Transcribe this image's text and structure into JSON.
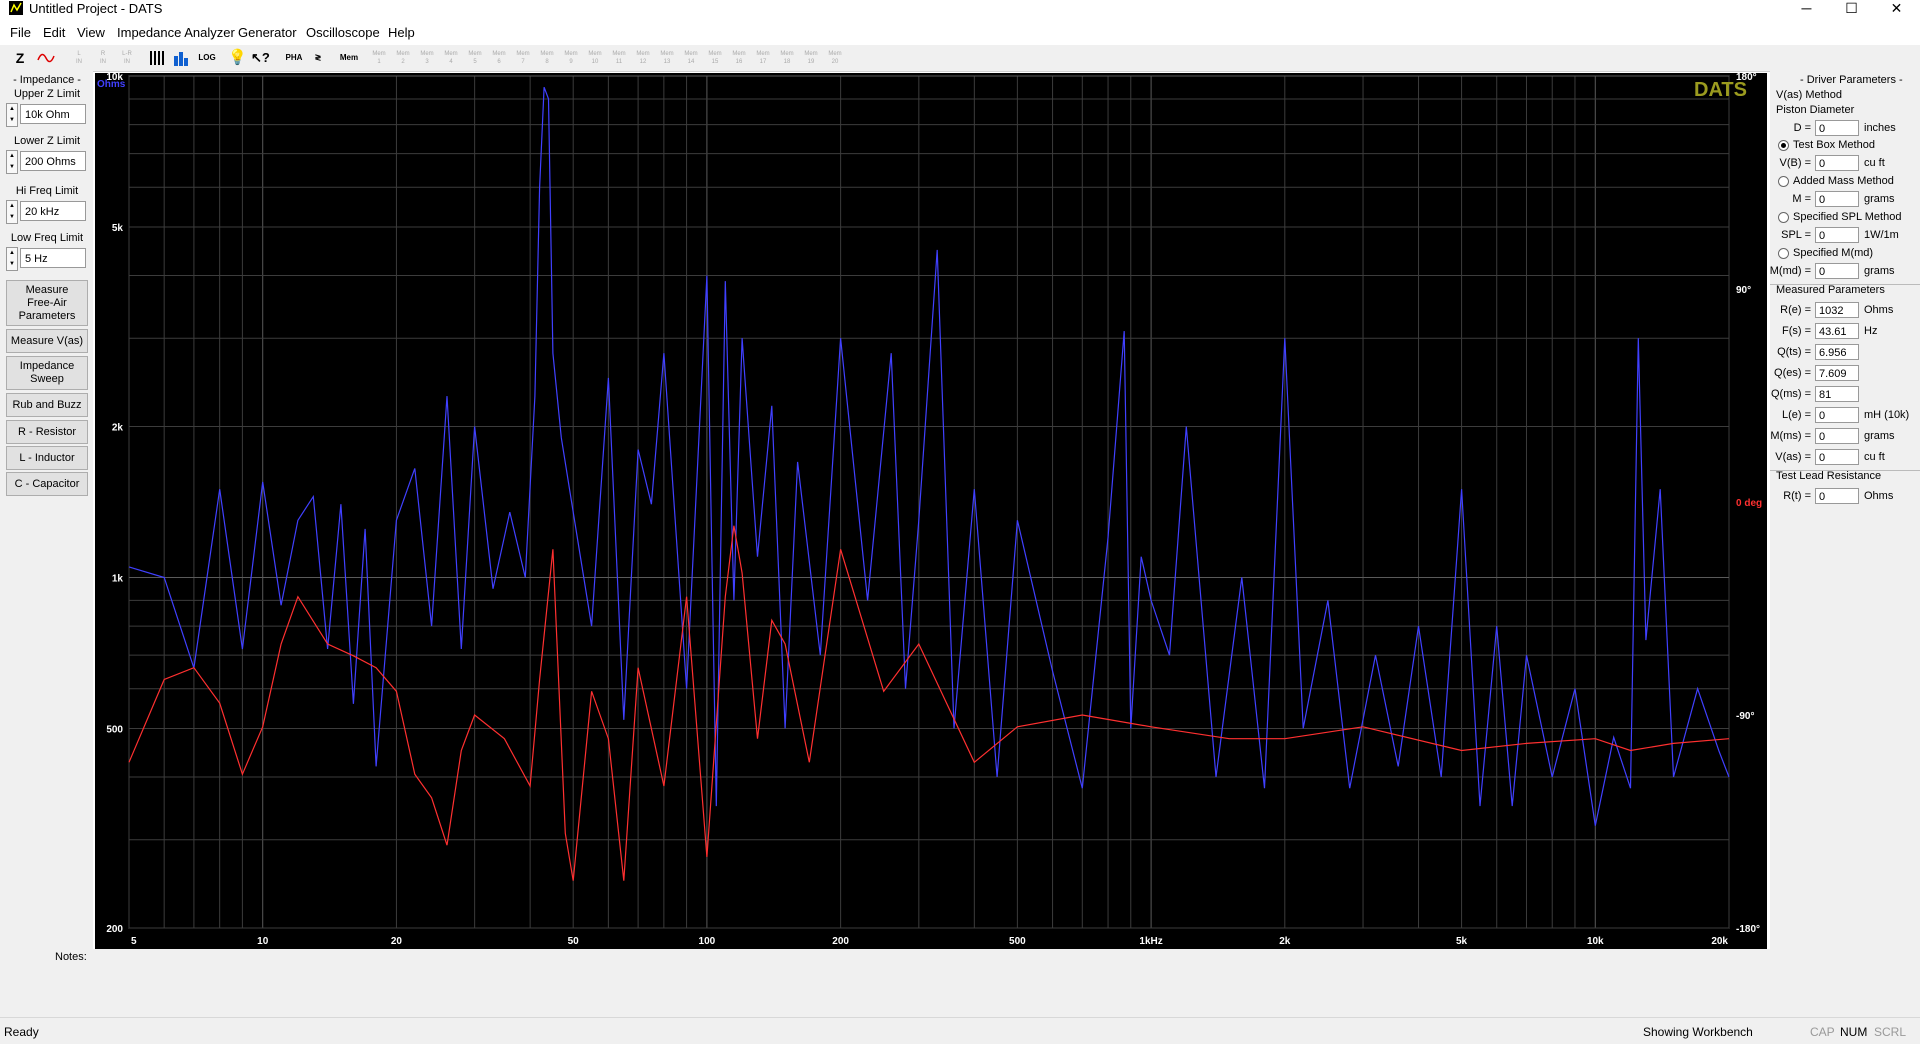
{
  "window": {
    "title": "Untitled Project - DATS",
    "minimize": "─",
    "maximize": "☐",
    "close": "✕"
  },
  "menu": [
    "File",
    "Edit",
    "View",
    "Impedance Analyzer",
    "Generator",
    "Oscilloscope",
    "Help"
  ],
  "toolbar": {
    "z_label": "Z",
    "pha_label": "PHA",
    "mem_label": "Mem"
  },
  "left_panel": {
    "impedance_heading": "- Impedance -",
    "upper_z_label": "Upper Z Limit",
    "upper_z_value": "10k Ohm",
    "lower_z_label": "Lower Z Limit",
    "lower_z_value": "200 Ohms",
    "hi_freq_label": "Hi Freq Limit",
    "hi_freq_value": "20 kHz",
    "low_freq_label": "Low Freq Limit",
    "low_freq_value": "5 Hz",
    "buttons": {
      "measure_free_air": [
        "Measure",
        "Free-Air",
        "Parameters"
      ],
      "measure_vas": "Measure V(as)",
      "impedance_sweep": [
        "Impedance",
        "Sweep"
      ],
      "rub_and_buzz": "Rub and Buzz",
      "resistor": "R - Resistor",
      "inductor": "L - Inductor",
      "capacitor": "C - Capacitor"
    }
  },
  "plot": {
    "watermark": "DATS",
    "left_unit": "Ohms",
    "left_ticks": [
      "10k",
      "5k",
      "2k",
      "1k",
      "500",
      "200"
    ],
    "right_ticks": [
      "180°",
      "90°",
      "0 deg",
      "-90°",
      "-180°"
    ],
    "x_ticks": [
      "5",
      "10",
      "20",
      "50",
      "100",
      "200",
      "500",
      "1kHz",
      "2k",
      "5k",
      "10k",
      "20k"
    ]
  },
  "right_panel": {
    "driver_heading": "- Driver Parameters -",
    "vas_method": "V(as) Method",
    "piston_diameter": "Piston Diameter",
    "d_label": "D =",
    "d_value": "0",
    "d_unit": "inches",
    "test_box": "Test Box Method",
    "vb_label": "V(B) =",
    "vb_value": "0",
    "vb_unit": "cu ft",
    "added_mass": "Added Mass Method",
    "m_label": "M =",
    "m_value": "0",
    "m_unit": "grams",
    "specified_spl": "Specified SPL Method",
    "spl_label": "SPL =",
    "spl_value": "0",
    "spl_unit": "1W/1m",
    "specified_mmd": "Specified M(md)",
    "mmd_label": "M(md) =",
    "mmd_value": "0",
    "mmd_unit": "grams",
    "measured_heading": "Measured Parameters",
    "re_label": "R(e) =",
    "re_value": "1032",
    "re_unit": "Ohms",
    "fs_label": "F(s) =",
    "fs_value": "43.61",
    "fs_unit": "Hz",
    "qts_label": "Q(ts) =",
    "qts_value": "6.956",
    "qes_label": "Q(es) =",
    "qes_value": "7.609",
    "qms_label": "Q(ms) =",
    "qms_value": "81",
    "le_label": "L(e) =",
    "le_value": "0",
    "le_unit": "mH (10k)",
    "mms_label": "M(ms) =",
    "mms_value": "0",
    "mms_unit": "grams",
    "vas_label": "V(as) =",
    "vas_value": "0",
    "vas_unit": "cu ft",
    "lead_heading": "Test Lead Resistance",
    "rt_label": "R(t) =",
    "rt_value": "0",
    "rt_unit": "Ohms"
  },
  "notes_label": "Notes:",
  "status": {
    "ready": "Ready",
    "mode": "Showing Workbench",
    "cap": "CAP",
    "num": "NUM",
    "scrl": "SCRL"
  },
  "colors": {
    "impedance": "#4040ff",
    "phase": "#ff3030",
    "watermark": "#9b9b1f",
    "grid": "#3c3c3c"
  },
  "chart_data": {
    "type": "line",
    "xscale": "log",
    "yscale": "log",
    "xlim": [
      5,
      20000
    ],
    "ylim": [
      200,
      10000
    ],
    "y2lim": [
      -180,
      180
    ],
    "series": [
      {
        "axis": "left",
        "x": [
          5,
          6,
          7,
          8,
          9,
          10,
          11,
          12,
          13,
          14,
          15,
          16,
          17,
          18,
          20,
          22,
          24,
          26,
          28,
          30,
          33,
          36,
          39,
          41,
          42,
          43,
          44,
          45,
          47,
          50,
          55,
          60,
          65,
          70,
          75,
          80,
          90,
          100,
          105,
          110,
          115,
          120,
          130,
          140,
          150,
          160,
          180,
          200,
          230,
          260,
          280,
          300,
          330,
          360,
          400,
          450,
          500,
          600,
          700,
          800,
          870,
          900,
          950,
          1000,
          1100,
          1200,
          1400,
          1600,
          1800,
          2000,
          2200,
          2500,
          2800,
          3200,
          3600,
          4000,
          4500,
          5000,
          5500,
          6000,
          6500,
          7000,
          8000,
          9000,
          10000,
          11000,
          12000,
          12500,
          13000,
          14000,
          15000,
          17000,
          19000,
          20000
        ],
        "values": [
          1050,
          1000,
          660,
          1500,
          720,
          1550,
          880,
          1300,
          1450,
          720,
          1400,
          560,
          1250,
          420,
          1300,
          1650,
          800,
          2300,
          720,
          2000,
          950,
          1350,
          1000,
          2300,
          6000,
          9500,
          9000,
          2800,
          1900,
          1350,
          800,
          2500,
          520,
          1800,
          1400,
          2800,
          600,
          4000,
          350,
          3900,
          900,
          3000,
          1100,
          2200,
          500,
          1700,
          700,
          3000,
          900,
          2800,
          600,
          1300,
          4500,
          500,
          1500,
          400,
          1300,
          650,
          380,
          1200,
          3100,
          500,
          1100,
          900,
          700,
          2000,
          400,
          1000,
          380,
          3000,
          500,
          900,
          380,
          700,
          420,
          800,
          400,
          1500,
          350,
          800,
          350,
          700,
          400,
          600,
          320,
          480,
          380,
          3000,
          750,
          1500,
          400,
          600,
          450,
          400
        ]
      },
      {
        "axis": "right",
        "x": [
          5,
          6,
          7,
          8,
          9,
          10,
          11,
          12,
          14,
          16,
          18,
          20,
          22,
          24,
          26,
          28,
          30,
          35,
          40,
          42,
          45,
          48,
          50,
          55,
          60,
          65,
          70,
          80,
          90,
          100,
          110,
          115,
          120,
          130,
          140,
          150,
          170,
          200,
          250,
          300,
          400,
          500,
          700,
          1000,
          1500,
          2000,
          3000,
          5000,
          7000,
          10000,
          12000,
          15000,
          20000
        ],
        "values": [
          -110,
          -75,
          -70,
          -85,
          -115,
          -95,
          -60,
          -40,
          -60,
          -65,
          -70,
          -80,
          -115,
          -125,
          -145,
          -105,
          -90,
          -100,
          -120,
          -75,
          -20,
          -140,
          -160,
          -80,
          -100,
          -160,
          -70,
          -120,
          -40,
          -150,
          -40,
          -10,
          -30,
          -100,
          -50,
          -60,
          -110,
          -20,
          -80,
          -60,
          -110,
          -95,
          -90,
          -95,
          -100,
          -100,
          -95,
          -105,
          -102,
          -100,
          -105,
          -102,
          -100
        ]
      }
    ]
  }
}
